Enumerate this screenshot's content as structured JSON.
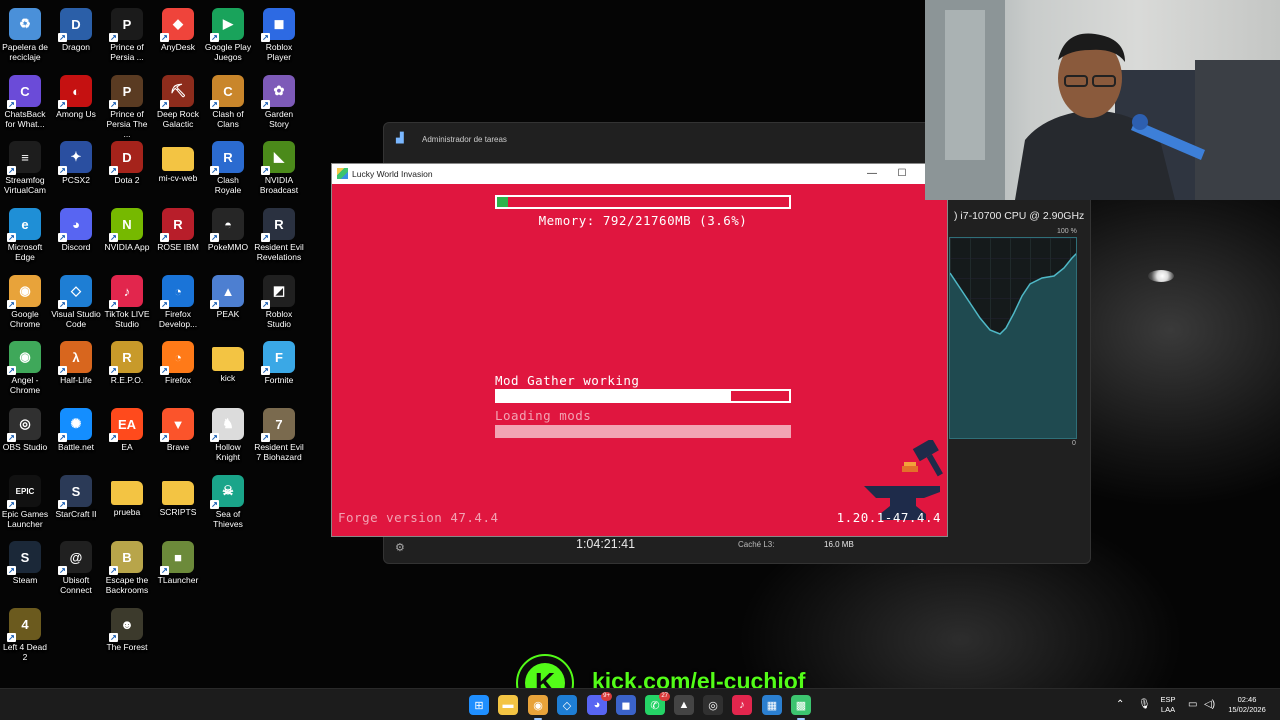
{
  "desktop_icons": [
    {
      "label": "Papelera de reciclaje",
      "icon": "recycle-bin-icon",
      "color": "#4a90d9",
      "glyph": "♻"
    },
    {
      "label": "ChatsBack for What...",
      "icon": "chatsback-icon",
      "color": "#6b4bd8",
      "glyph": "C"
    },
    {
      "label": "Streamfog VirtualCam",
      "icon": "streamfog-icon",
      "color": "#1d1d1d",
      "glyph": "≡"
    },
    {
      "label": "Microsoft Edge",
      "icon": "edge-icon",
      "color": "#1f8fd6",
      "glyph": "e"
    },
    {
      "label": "Google Chrome",
      "icon": "chrome-icon",
      "color": "#e8a33a",
      "glyph": "◉"
    },
    {
      "label": "Angel - Chrome",
      "icon": "angel-chrome-icon",
      "color": "#3fa85a",
      "glyph": "◉"
    },
    {
      "label": "OBS Studio",
      "icon": "obs-icon",
      "color": "#303030",
      "glyph": "◎"
    },
    {
      "label": "Epic Games Launcher",
      "icon": "epic-games-icon",
      "color": "#111111",
      "glyph": "EPIC"
    },
    {
      "label": "Steam",
      "icon": "steam-icon",
      "color": "#1b2838",
      "glyph": "S"
    },
    {
      "label": "Left 4 Dead 2",
      "icon": "left4dead-icon",
      "color": "#6b5a1e",
      "glyph": "4"
    },
    {
      "label": "Dragon",
      "icon": "dragon-icon",
      "color": "#2b5fa8",
      "glyph": "D"
    },
    {
      "label": "Among Us",
      "icon": "among-us-icon",
      "color": "#c51111",
      "glyph": "◐"
    },
    {
      "label": "PCSX2",
      "icon": "pcsx2-icon",
      "color": "#2a4fa0",
      "glyph": "✦"
    },
    {
      "label": "Discord",
      "icon": "discord-icon",
      "color": "#5865f2",
      "glyph": "◕"
    },
    {
      "label": "Visual Studio Code",
      "icon": "vscode-icon",
      "color": "#1e7ed4",
      "glyph": "◇"
    },
    {
      "label": "Half-Life",
      "icon": "half-life-icon",
      "color": "#d8661e",
      "glyph": "λ"
    },
    {
      "label": "Battle.net",
      "icon": "battlenet-icon",
      "color": "#148eff",
      "glyph": "✺"
    },
    {
      "label": "StarCraft II",
      "icon": "starcraft-icon",
      "color": "#2b3a57",
      "glyph": "S"
    },
    {
      "label": "Ubisoft Connect",
      "icon": "ubisoft-icon",
      "color": "#202020",
      "glyph": "@"
    },
    {
      "label": "Prince of Persia ...",
      "icon": "prince-persia-icon",
      "color": "#1b1b1b",
      "glyph": "P"
    },
    {
      "label": "Prince of Persia The ...",
      "icon": "prince-persia-2-icon",
      "color": "#5a3b22",
      "glyph": "P"
    },
    {
      "label": "Dota 2",
      "icon": "dota2-icon",
      "color": "#a5231b",
      "glyph": "D"
    },
    {
      "label": "NVIDIA App",
      "icon": "nvidia-icon",
      "color": "#76b900",
      "glyph": "N"
    },
    {
      "label": "TikTok LIVE Studio",
      "icon": "tiktok-live-icon",
      "color": "#e2264d",
      "glyph": "♪"
    },
    {
      "label": "R.E.P.O.",
      "icon": "repo-icon",
      "color": "#c89a2a",
      "glyph": "R"
    },
    {
      "label": "EA",
      "icon": "ea-icon",
      "color": "#ff4a1c",
      "glyph": "EA"
    },
    {
      "label": "Folder prueba",
      "icon": "folder-icon",
      "color": "#f3c443",
      "glyph": ""
    },
    {
      "label": "Escape the Backrooms",
      "icon": "backrooms-icon",
      "color": "#b8a54a",
      "glyph": "B"
    },
    {
      "label": "The Forest",
      "icon": "the-forest-icon",
      "color": "#3c3a2c",
      "glyph": "☻"
    },
    {
      "label": "AnyDesk",
      "icon": "anydesk-icon",
      "color": "#ef443b",
      "glyph": "◆"
    },
    {
      "label": "Deep Rock Galactic",
      "icon": "deep-rock-icon",
      "color": "#8d2c1c",
      "glyph": "⛏"
    },
    {
      "label": "mi-cv-web",
      "icon": "folder-cv-icon",
      "color": "#f3c443",
      "glyph": ""
    },
    {
      "label": "ROSE IBM",
      "icon": "rose-ibm-icon",
      "color": "#b81e2a",
      "glyph": "R"
    },
    {
      "label": "Firefox Develop...",
      "icon": "firefox-dev-icon",
      "color": "#1a74d8",
      "glyph": "◔"
    },
    {
      "label": "Firefox",
      "icon": "firefox-icon",
      "color": "#ff7a18",
      "glyph": "◔"
    },
    {
      "label": "Brave",
      "icon": "brave-icon",
      "color": "#fb542b",
      "glyph": "▼"
    },
    {
      "label": "SCRIPTS",
      "icon": "folder-scripts-icon",
      "color": "#f3c443",
      "glyph": ""
    },
    {
      "label": "TLauncher",
      "icon": "tlauncher-icon",
      "color": "#6c8a3a",
      "glyph": "■"
    },
    {
      "label": "Google Play Juegos",
      "icon": "google-play-icon",
      "color": "#19a35b",
      "glyph": "▶"
    },
    {
      "label": "Clash of Clans",
      "icon": "clash-clans-icon",
      "color": "#c9862b",
      "glyph": "C"
    },
    {
      "label": "Clash Royale",
      "icon": "clash-royale-icon",
      "color": "#2b6bd0",
      "glyph": "R"
    },
    {
      "label": "PokeMMO",
      "icon": "pokemmo-icon",
      "color": "#262626",
      "glyph": "◓"
    },
    {
      "label": "PEAK",
      "icon": "peak-icon",
      "color": "#4d7fd1",
      "glyph": "▲"
    },
    {
      "label": "kick",
      "icon": "folder-kick-icon",
      "color": "#f3c443",
      "glyph": ""
    },
    {
      "label": "Hollow Knight",
      "icon": "hollow-knight-icon",
      "color": "#dcdcdc",
      "glyph": "♞"
    },
    {
      "label": "Sea of Thieves",
      "icon": "sea-thieves-icon",
      "color": "#1aa58a",
      "glyph": "☠"
    },
    {
      "label": "Roblox Player",
      "icon": "roblox-player-icon",
      "color": "#2d6ae3",
      "glyph": "◼"
    },
    {
      "label": "Garden Story",
      "icon": "garden-story-icon",
      "color": "#7d5ab8",
      "glyph": "✿"
    },
    {
      "label": "NVIDIA Broadcast",
      "icon": "nvidia-broadcast-icon",
      "color": "#4b8a1a",
      "glyph": "◣"
    },
    {
      "label": "Resident Evil Revelations",
      "icon": "re-revelations-icon",
      "color": "#2a3140",
      "glyph": "R"
    },
    {
      "label": "Roblox Studio",
      "icon": "roblox-studio-icon",
      "color": "#202020",
      "glyph": "◩"
    },
    {
      "label": "Fortnite",
      "icon": "fortnite-icon",
      "color": "#3aa8e6",
      "glyph": "F"
    },
    {
      "label": "Resident Evil 7 Biohazard",
      "icon": "re7-icon",
      "color": "#7a6a4e",
      "glyph": "7"
    }
  ],
  "task_manager": {
    "title": "Administrador de tareas",
    "cpu_name": ") i7-10700 CPU @ 2.90GHz",
    "graph_max": "100 %",
    "graph_min": "0",
    "uptime": "1:04:21:41",
    "cache_label": "Caché L3:",
    "cache_value": "16.0 MB",
    "graph_color": "#2f8f9b"
  },
  "loader_window": {
    "title": "Lucky World Invasion",
    "memory_text": "Memory: 792/21760MB (3.6%)",
    "memory_fraction": 0.036,
    "task_label": "Mod Gather working",
    "task_progress": 0.8,
    "sub_label": "Loading mods",
    "sub_progress": 1.0,
    "forge_version": "Forge version 47.4.4",
    "mc_version": "1.20.1-47.4.4",
    "bg_color": "#e0163f",
    "memory_bar_color": "#2db34a"
  },
  "overlay": {
    "kick_glyph": "K",
    "kick_url": "kick.com/el-cuchiof",
    "brand_color": "#53fc18"
  },
  "taskbar": {
    "icons": [
      {
        "name": "start-icon",
        "glyph": "⊞",
        "color": "#1f8fff"
      },
      {
        "name": "file-explorer-icon",
        "glyph": "▬",
        "color": "#f3c443"
      },
      {
        "name": "chrome-taskbar-icon",
        "glyph": "◉",
        "color": "#e8a33a"
      },
      {
        "name": "vscode-taskbar-icon",
        "glyph": "◇",
        "color": "#1e7ed4"
      },
      {
        "name": "discord-taskbar-icon",
        "glyph": "◕",
        "color": "#5865f2",
        "badge": "9+"
      },
      {
        "name": "app-taskbar-icon",
        "glyph": "◼",
        "color": "#3b63c9"
      },
      {
        "name": "whatsapp-taskbar-icon",
        "glyph": "✆",
        "color": "#25d366",
        "badge": "27"
      },
      {
        "name": "cursor-taskbar-icon",
        "glyph": "▲",
        "color": "#444444"
      },
      {
        "name": "obs-taskbar-icon",
        "glyph": "◎",
        "color": "#303030"
      },
      {
        "name": "tiktok-taskbar-icon",
        "glyph": "♪",
        "color": "#e2264d"
      },
      {
        "name": "photos-taskbar-icon",
        "glyph": "▦",
        "color": "#2b7fd0"
      },
      {
        "name": "minecraft-taskbar-icon",
        "glyph": "▩",
        "color": "#3cc46f"
      }
    ],
    "language_top": "ESP",
    "language_bottom": "LAA",
    "time": "02:46",
    "date": "15/02/2026"
  }
}
